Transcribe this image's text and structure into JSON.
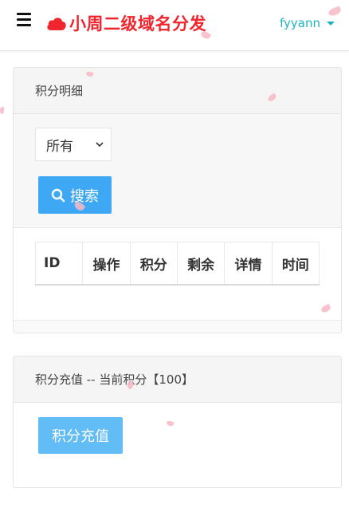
{
  "navbar": {
    "title": "小周二级域名分发",
    "username": "fyyann",
    "brand_color": "#f0252d",
    "accent_color": "#1eb3bb"
  },
  "points_detail": {
    "header": "积分明细",
    "filter_select": {
      "selected": "所有"
    },
    "search_label": "搜索",
    "table": {
      "columns": [
        "ID",
        "操作",
        "积分",
        "剩余",
        "详情",
        "时间"
      ],
      "rows": []
    }
  },
  "recharge": {
    "header": "积分充值 -- 当前积分【100】",
    "button_label": "积分充值"
  },
  "icons": {
    "menu": "hamburger-menu-icon",
    "brand": "cloud-icon",
    "dropdown": "caret-down-icon",
    "select": "chevron-down-icon",
    "search": "search-icon"
  }
}
